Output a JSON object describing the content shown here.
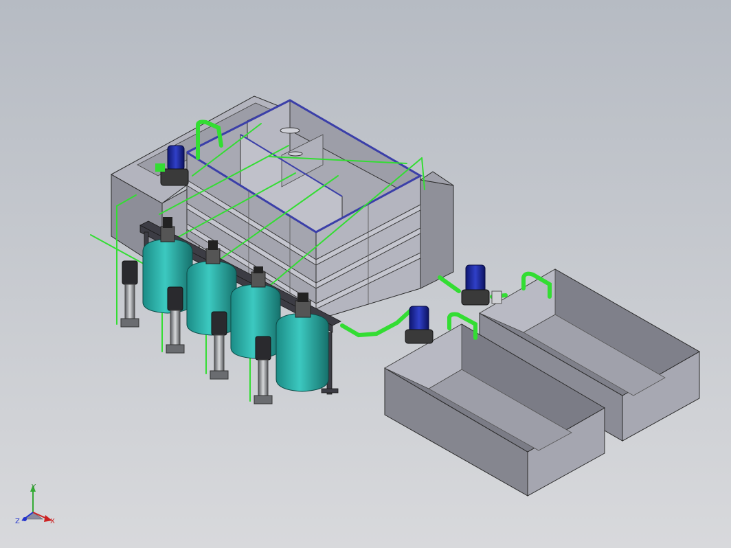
{
  "triad": {
    "x_label": "X",
    "y_label": "Y",
    "z_label": "Z"
  },
  "colors": {
    "background_top": "#b6bbc3",
    "background_bottom": "#d8d9dc",
    "tank_face": "#a9aab3",
    "tank_dark": "#7d7e86",
    "tank_inner": "#9b9ca6",
    "pipe": "#33dd33",
    "filter_vessel": "#2bb6ae",
    "pump_motor": "#1a2aa0",
    "frame": "#3c3c44"
  },
  "objects": [
    "main-treatment-tank",
    "left-buffer-tank",
    "right-side-tank",
    "filter-vessel-row",
    "vertical-pump-row",
    "horizontal-pump",
    "clean-water-tank-front",
    "clean-water-tank-back",
    "green-pipe-network"
  ]
}
